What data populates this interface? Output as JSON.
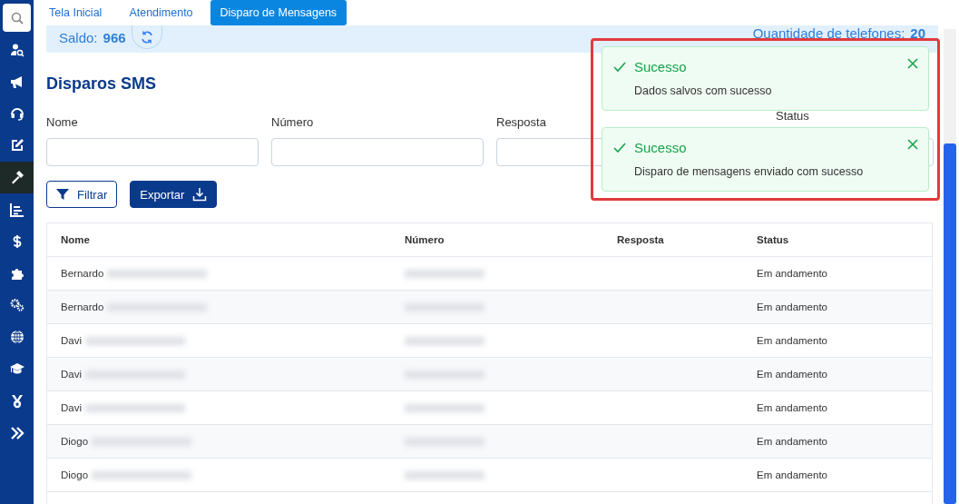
{
  "sidebar": {
    "items": [
      {
        "kind": "search",
        "selected": false
      },
      {
        "kind": "user-search",
        "selected": false
      },
      {
        "kind": "megaphone",
        "selected": false
      },
      {
        "kind": "headset",
        "selected": false
      },
      {
        "kind": "edit",
        "selected": false
      },
      {
        "kind": "hammer",
        "selected": true
      },
      {
        "kind": "chart",
        "selected": false
      },
      {
        "kind": "dollar",
        "selected": false
      },
      {
        "kind": "puzzle",
        "selected": false
      },
      {
        "kind": "gears",
        "selected": false
      },
      {
        "kind": "globe",
        "selected": false
      },
      {
        "kind": "cap",
        "selected": false
      },
      {
        "kind": "medal",
        "selected": false
      },
      {
        "kind": "expand",
        "selected": false
      }
    ]
  },
  "tabs": [
    {
      "label": "Tela Inicial",
      "selected": false
    },
    {
      "label": "Atendimento",
      "selected": false
    },
    {
      "label": "Disparo de Mensagens",
      "selected": true
    }
  ],
  "balance": {
    "label": "Saldo:",
    "value": "966",
    "phones_label": "Quantidade de telefones:",
    "phones_value": "20"
  },
  "heading": "Disparos SMS",
  "filters": [
    {
      "label": "Nome"
    },
    {
      "label": "Número"
    },
    {
      "label": "Resposta"
    },
    {
      "label": "Status"
    }
  ],
  "buttons": [
    {
      "kind": "filter",
      "label": "Filtrar"
    },
    {
      "kind": "export",
      "label": "Exportar"
    }
  ],
  "table": {
    "columns": [
      "Nome",
      "Número",
      "Resposta",
      "Status"
    ],
    "rows": [
      {
        "name": "Bernardo",
        "status": "Em andamento"
      },
      {
        "name": "Bernardo",
        "status": "Em andamento"
      },
      {
        "name": "Davi",
        "status": "Em andamento"
      },
      {
        "name": "Davi",
        "status": "Em andamento"
      },
      {
        "name": "Davi",
        "status": "Em andamento"
      },
      {
        "name": "Diogo",
        "status": "Em andamento"
      },
      {
        "name": "Diogo",
        "status": "Em andamento"
      }
    ]
  },
  "toasts": [
    {
      "title": "Sucesso",
      "message": "Dados salvos com sucesso"
    },
    {
      "title": "Sucesso",
      "message": "Disparo de mensagens enviado com sucesso"
    }
  ]
}
